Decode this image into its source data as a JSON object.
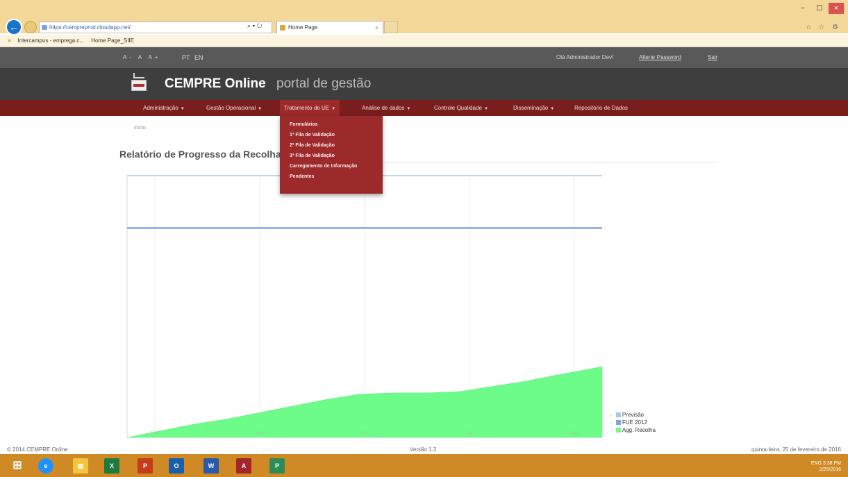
{
  "browser": {
    "back_label": "←",
    "url": "https://cempreprod.cloudapp.net/",
    "search_refresh": "⌕ ▾ ↻",
    "tab_title": "Home Page",
    "tab_close": "×",
    "window_controls": [
      "−",
      "☐",
      "×"
    ],
    "toolbar_icons": "⌂ ☆ ⚙",
    "favorites": [
      "Intercampus - emprega.c...",
      "Home Page_SIIE"
    ]
  },
  "top_bar": {
    "font_sizes": "A- A A+",
    "lang_pt": "PT",
    "lang_en": "EN",
    "greeting": "Olá Administrador Dev!",
    "change_password": "Alterar Password",
    "logout": "Sair"
  },
  "header": {
    "site_name": "CEMPRE Online",
    "tagline": "portal de gestão"
  },
  "nav": {
    "items": [
      {
        "label": "Administração"
      },
      {
        "label": "Gestão Operacional"
      },
      {
        "label": "Tratamento de UE"
      },
      {
        "label": "Análise de dados"
      },
      {
        "label": "Controle Qualidade"
      },
      {
        "label": "Disseminação"
      },
      {
        "label": "Repositório de Dados"
      }
    ],
    "caret": "▼",
    "dropdown": [
      "Formulários",
      "1ª Fila de Validação",
      "2ª Fila de Validação",
      "3ª Fila de Validação",
      "Carregamento de Informação",
      "Pendentes"
    ]
  },
  "page": {
    "breadcrumb": "Início",
    "title": "Relatório de Progresso da Recolha"
  },
  "chart_data": {
    "type": "area",
    "x_tick_labels": [
      "Oct",
      "Nov",
      "Dec",
      "Jan",
      "Feb"
    ],
    "y_tick_labels": [],
    "ylim": [
      0,
      100
    ],
    "series": [
      {
        "name": "Previsão",
        "color": "#a8c8e8",
        "kind": "line",
        "values": [
          100,
          100
        ]
      },
      {
        "name": "FUE 2012",
        "color": "#7ea7d8",
        "kind": "line",
        "values": [
          80,
          80
        ]
      },
      {
        "name": "Agg. Recolha",
        "color": "#6dfc8a",
        "kind": "area",
        "x": [
          0,
          0.07,
          0.14,
          0.21,
          0.28,
          0.35,
          0.42,
          0.49,
          0.56,
          0.63,
          0.7,
          0.77,
          0.84,
          0.91,
          1.0
        ],
        "values": [
          0,
          2.5,
          5,
          7,
          9.5,
          12,
          14.5,
          16.5,
          17,
          17,
          17.5,
          19.5,
          21.5,
          24,
          27
        ]
      }
    ],
    "grid": true,
    "legend_position": "bottom-right"
  },
  "footer": {
    "copyright": "© 2014 CEMPRE Online",
    "version": "Versão 1.3",
    "date": "quinta-feira, 25 de fevereiro de 2016"
  },
  "taskbar": {
    "start": "⊞",
    "apps": [
      "e",
      "▤",
      "X",
      "P",
      "O",
      "W",
      "A",
      "P"
    ],
    "tray": "ENG  3:38 PM",
    "tray_date": "2/25/2016"
  }
}
